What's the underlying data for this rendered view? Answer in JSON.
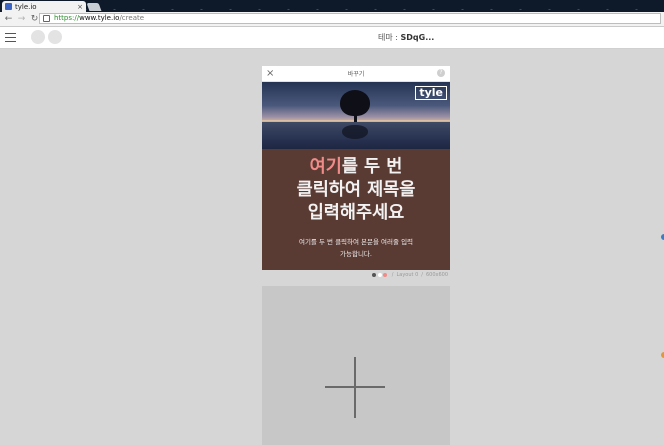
{
  "browser": {
    "tab_title": "tyle.io",
    "tab_close": "×",
    "url_scheme": "https://",
    "url_host": "www.tyle.io",
    "url_path": "/create",
    "back_icon": "arrow-left-icon",
    "forward_icon": "arrow-right-icon",
    "reload_icon": "reload-icon"
  },
  "app": {
    "theme_label": "테마 : ",
    "theme_value": "SDqG..."
  },
  "card": {
    "top_title": "바꾸기",
    "close_glyph": "×",
    "help_glyph": "?",
    "logo": "tyle",
    "headline_highlight": "여기",
    "headline_line1_rest": "를 두 번",
    "headline_line2": "클릭하여 제목을",
    "headline_line3": "입력해주세요",
    "body_line1": "여기를 두 번 클릭하여 본문을 여러줄 입력",
    "body_line2": "가능합니다.",
    "meta_layout": "Layout 0",
    "meta_size": "600x600",
    "meta_sep": "/",
    "bg_color": "#5a3b34",
    "highlight_color": "#f08b88",
    "dots": [
      "#555555",
      "#ffffff",
      "#f08b88"
    ]
  }
}
